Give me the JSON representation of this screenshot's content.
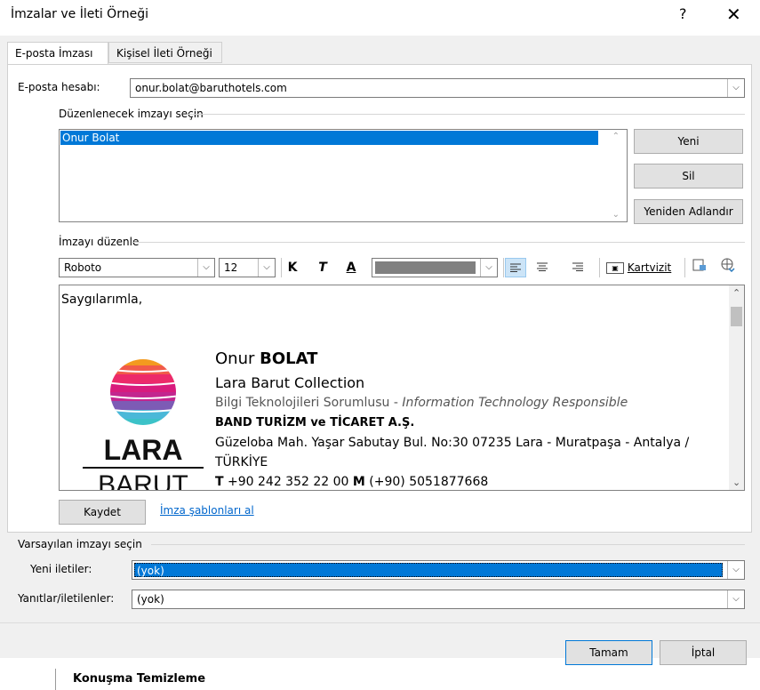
{
  "window": {
    "title": "İmzalar ve İleti Örneği",
    "help_glyph": "?",
    "close_glyph": "✕"
  },
  "tabs": [
    "E-posta İmzası",
    "Kişisel İleti Örneği"
  ],
  "account": {
    "label": "E-posta hesabı:",
    "value": "onur.bolat@baruthotels.com"
  },
  "select_group": {
    "label": "Düzenlenecek imzayı seçin",
    "items": [
      "Onur Bolat"
    ]
  },
  "buttons": {
    "new": "Yeni",
    "delete": "Sil",
    "rename": "Yeniden Adlandır",
    "save": "Kaydet",
    "templates": "İmza şablonları al",
    "ok": "Tamam",
    "cancel": "İptal"
  },
  "edit_group": {
    "label": "İmzayı düzenle"
  },
  "toolbar": {
    "font": "Roboto",
    "size": "12",
    "bold": "K",
    "italic": "T",
    "underline": "A",
    "business_card": "Kartvizit"
  },
  "signature": {
    "greeting": "Saygılarımla,",
    "name_first": "Onur ",
    "name_last": "BOLAT",
    "company": "Lara Barut Collection",
    "role_tr": "Bilgi Teknolojileri Sorumlusu - ",
    "role_en": "Information Technology Responsible",
    "legal": "BAND TURİZM ve TİCARET A.Ş.",
    "address1": "Güzeloba Mah. Yaşar Sabutay Bul. No:30 07235 Lara - Muratpaşa - Antalya /",
    "address2": "TÜRKİYE",
    "tel_prefix": "T",
    "tel": " +90 242 352 22 00 ",
    "mobile_prefix": "M",
    "mobile": " (+90) 5051877668",
    "logo_line1": "LARA",
    "logo_line2": "BARUT"
  },
  "defaults": {
    "label": "Varsayılan imzayı seçin",
    "new_label": "Yeni iletiler:",
    "new_value": "(yok)",
    "reply_label": "Yanıtlar/iletilenler:",
    "reply_value": "(yok)"
  },
  "background_text": "Konuşma Temizleme",
  "colors": {
    "selection": "#0078d7",
    "link": "#0066cc"
  }
}
